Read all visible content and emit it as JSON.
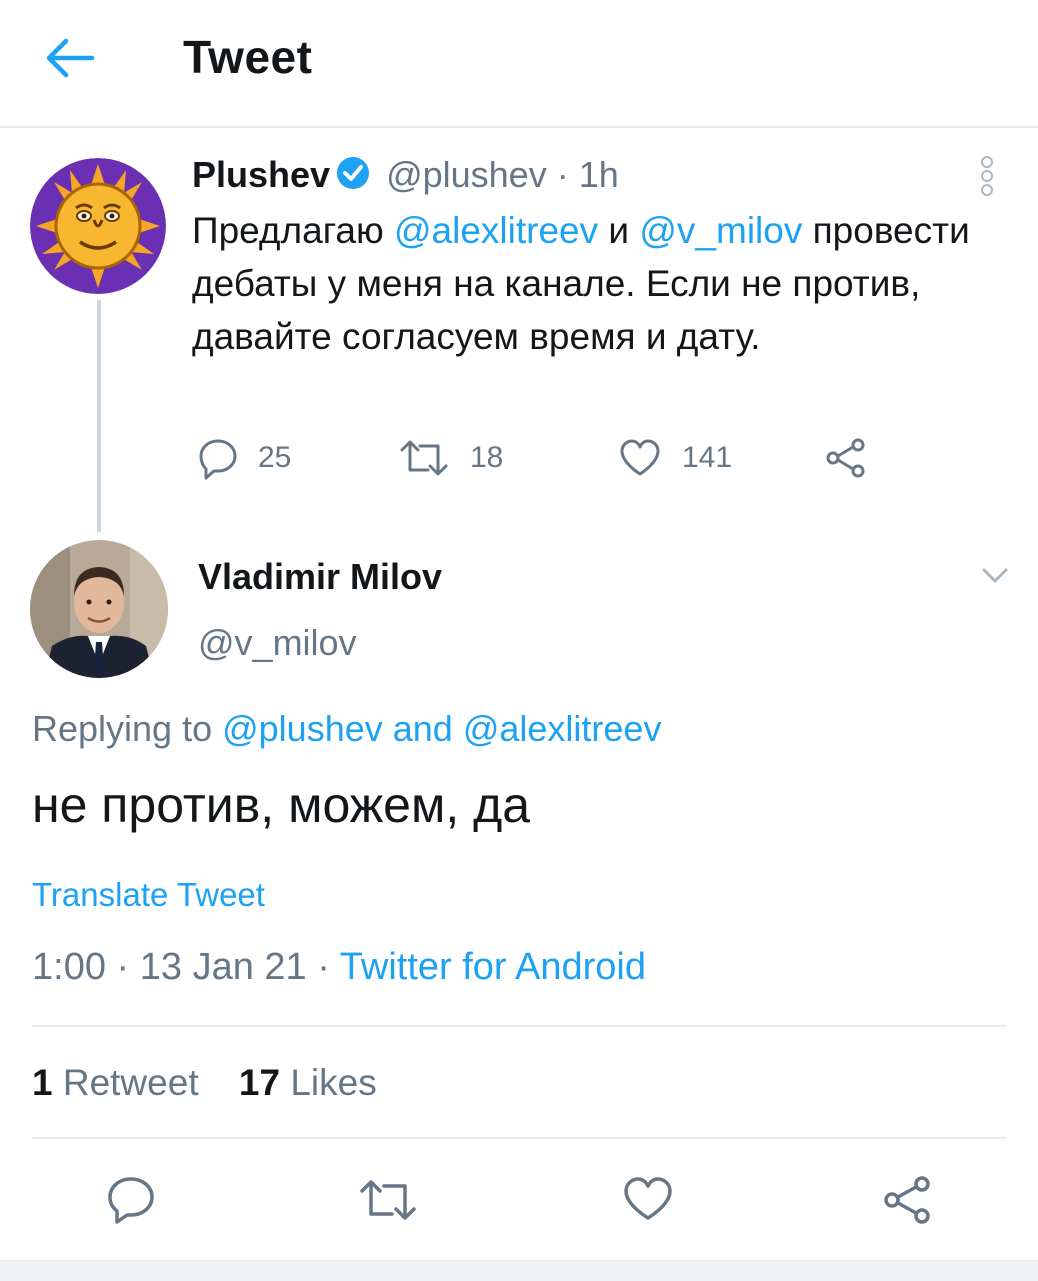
{
  "header": {
    "title": "Tweet",
    "back_icon": "arrow-left-icon"
  },
  "colors": {
    "accent": "#1da1f2",
    "text": "#14171a",
    "muted": "#657786",
    "divider": "#e6ecf0"
  },
  "parent_tweet": {
    "name": "Plushev",
    "verified": true,
    "handle": "@plushev",
    "separator": "·",
    "time": "1h",
    "body": {
      "part1": "Предлагаю ",
      "mention1": "@alexlitreev",
      "part2": " и ",
      "mention2": "@v_milov",
      "part3": " провести дебаты у меня на канале. Если не против, давайте согласуем время и дату."
    },
    "actions": {
      "replies": "25",
      "retweets": "18",
      "likes": "141"
    }
  },
  "reply_tweet": {
    "name": "Vladimir Milov",
    "handle": "@v_milov",
    "replying_label": "Replying to ",
    "replying_user1": "@plushev",
    "replying_and": " and ",
    "replying_user2": "@alexlitreev",
    "text": "не против, можем, да",
    "translate": "Translate Tweet",
    "time": "1:00",
    "dot1": " · ",
    "date": "13 Jan 21",
    "dot2": " · ",
    "source": "Twitter for Android",
    "stats": {
      "retweets_count": "1",
      "retweets_label": "Retweet",
      "likes_count": "17",
      "likes_label": "Likes"
    }
  }
}
